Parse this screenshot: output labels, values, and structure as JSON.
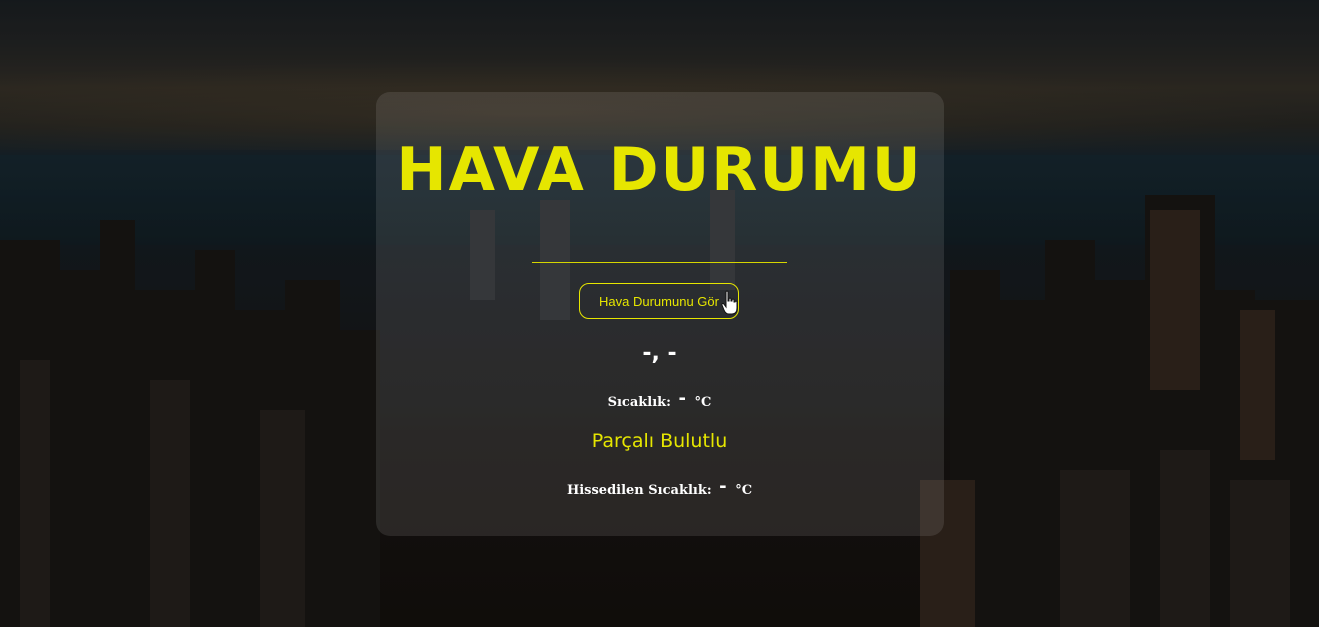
{
  "page": {
    "title": "HAVA DURUMU"
  },
  "actions": {
    "show_weather_label": "Hava Durumunu Gör"
  },
  "weather": {
    "city_country": "-, -",
    "temperature_label": "Sıcaklık:",
    "temperature_value": "-",
    "temperature_unit": "°C",
    "description": "Parçalı Bulutlu",
    "feels_like_label": "Hissedilen Sıcaklık:",
    "feels_like_value": "-",
    "feels_like_unit": "°C"
  },
  "colors": {
    "accent": "#e6e600",
    "text": "#ffffff",
    "card_bg": "rgba(255,255,255,0.10)"
  },
  "icons": {
    "cursor": "hand-pointer-icon"
  }
}
